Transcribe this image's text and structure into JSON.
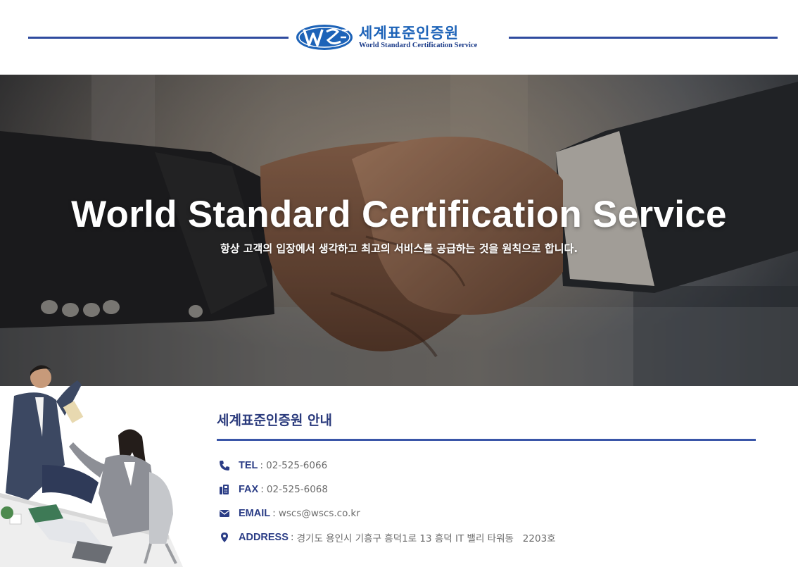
{
  "header": {
    "logo_mark": "WSCS",
    "logo_korean": "세계표준인증원",
    "logo_english": "World Standard Certification Service",
    "accent_color": "#2f4b9f"
  },
  "hero": {
    "title": "World Standard Certification Service",
    "subtitle": "항상 고객의 입장에서 생각하고 최고의 서비스를 공급하는 것을 원칙으로 합니다.",
    "image": "handshake-photo"
  },
  "info": {
    "title": "세계표준인증원 안내",
    "rows": [
      {
        "icon": "phone-icon",
        "label": "TEL",
        "value": "02-525-6066"
      },
      {
        "icon": "fax-icon",
        "label": "FAX",
        "value": "02-525-6068"
      },
      {
        "icon": "email-icon",
        "label": "EMAIL",
        "value": "wscs@wscs.co.kr"
      },
      {
        "icon": "location-pin-icon",
        "label": "ADDRESS",
        "value": "경기도 용인시 기흥구 흥덕1로 13 흥덕 IT 밸리 타워동   2203호"
      }
    ]
  },
  "illustration": "business-people-high-five-photo"
}
